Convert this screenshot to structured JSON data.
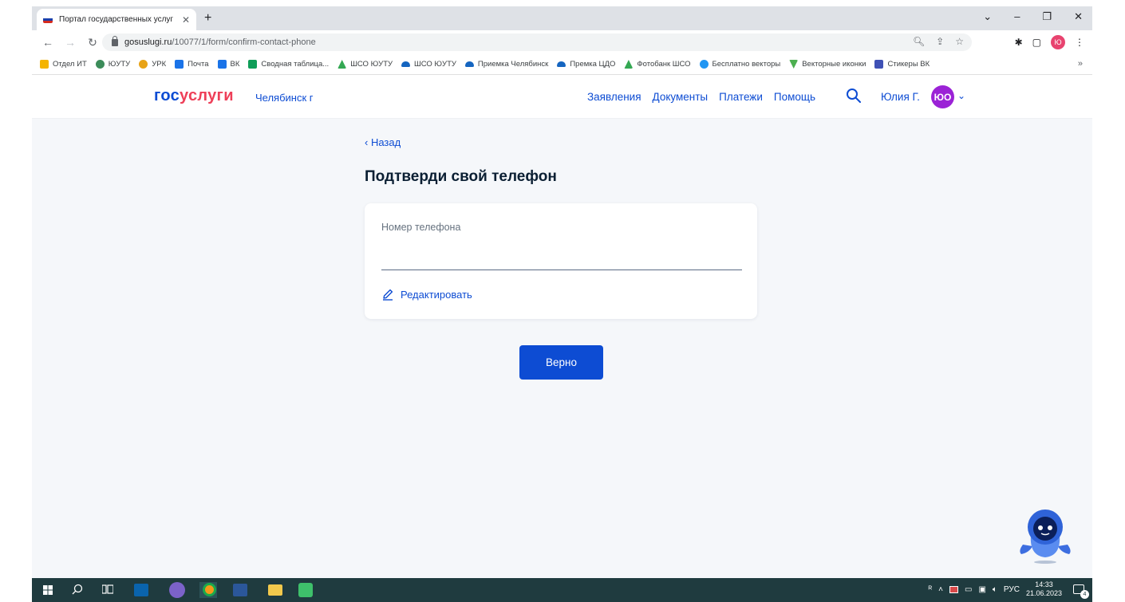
{
  "browser": {
    "tab_title": "Портал государственных услуг",
    "tab_close": "✕",
    "new_tab": "+",
    "window_controls": [
      "⌄",
      "–",
      "❐",
      "✕"
    ],
    "url_host": "gosuslugi.ru",
    "url_path": "/10077/1/form/confirm-contact-phone",
    "profile_letter": "Ю",
    "bookmarks": [
      {
        "label": "Отдел ИТ",
        "color": "#f4b400"
      },
      {
        "label": "ЮУТУ",
        "color": "#3c8c5a"
      },
      {
        "label": "УРК",
        "color": "#e8a317"
      },
      {
        "label": "Почта",
        "color": "#1a73e8"
      },
      {
        "label": "ВК",
        "color": "#1a73e8"
      },
      {
        "label": "Сводная таблица...",
        "color": "#0f9d58"
      },
      {
        "label": "ШСО ЮУТУ",
        "color": "#34a853"
      },
      {
        "label": "ШСО ЮУТУ",
        "color": "#1565c0"
      },
      {
        "label": "Приемка Челябинск",
        "color": "#1565c0"
      },
      {
        "label": "Премка ЦДО",
        "color": "#1565c0"
      },
      {
        "label": "Фотобанк ШСО",
        "color": "#34a853"
      },
      {
        "label": "Бесплатно векторы",
        "color": "#2196f3"
      },
      {
        "label": "Векторные иконки",
        "color": "#4caf50"
      },
      {
        "label": "Стикеры ВК",
        "color": "#3f51b5"
      }
    ],
    "bookmarks_more": "»"
  },
  "site": {
    "logo_part1": "гос",
    "logo_part2": "услуги",
    "city": "Челябинск г",
    "nav": [
      "Заявления",
      "Документы",
      "Платежи",
      "Помощь"
    ],
    "user_name": "Юлия Г.",
    "avatar_initials": "ЮО"
  },
  "form": {
    "back_label": "Назад",
    "title": "Подтверди свой телефон",
    "phone_label": "Номер телефона",
    "phone_value": "",
    "edit_label": "Редактировать",
    "confirm_label": "Верно"
  },
  "taskbar": {
    "lang": "РУС",
    "time": "14:33",
    "date": "21.06.2023",
    "notifications": "4"
  },
  "colors": {
    "accent": "#0d4cd3",
    "logo_red": "#ee3f58",
    "avatar": "#9b22d6",
    "page_bg": "#f5f7fa",
    "taskbar": "#1f3b3f"
  }
}
